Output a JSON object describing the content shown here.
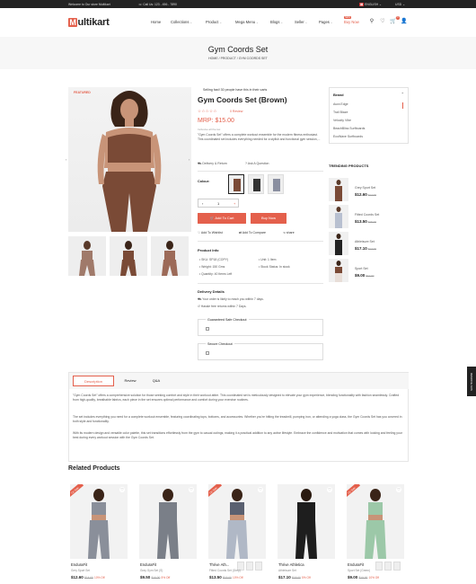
{
  "topbar": {
    "welcome": "Welcome to Our store Multikart",
    "phone": "Call Us: 123 - 456 - 7890",
    "language": "ENGLISH",
    "currency": "USD"
  },
  "logo": {
    "letter": "M",
    "rest": "ultikart"
  },
  "nav": {
    "items": [
      "Home",
      "Collections",
      "Product",
      "Mega Menu",
      "Blogs",
      "Seller",
      "Pages",
      "Buy Now"
    ],
    "new_badge": "NEW",
    "cart_count": "0"
  },
  "banner": {
    "title": "Gym Coords Set",
    "breadcrumb": "HOME  /  PRODUCT  /  GYM COORDS SET"
  },
  "gallery": {
    "featured": "FEATURED"
  },
  "product": {
    "selling_info": "Selling fast! 30 people have this in their carts",
    "title": "Gym Coords Set (Brown)",
    "stars": "☆☆☆☆☆",
    "review_link": "0 Review",
    "mrp": "MRP: $15.00",
    "tax": "Inclusive all the tax",
    "description": "\"Gym Coords Set\" offers a complete workout ensemble for the modern fitness enthusiast. This coordinated set includes everything needed for a stylish and functional gym session,...",
    "delivery_return": "Delivery & Return",
    "ask_question": "Ask A Question",
    "colour_label": "Colour:",
    "qty_minus": "‹",
    "qty_value": "1",
    "qty_plus": "+",
    "add_to_cart": "Add To Cart",
    "buy_now": "Buy Now",
    "wishlist": "Add To Wishlist",
    "compare": "Add To Compare",
    "share": "share",
    "info_heading": "Product Info",
    "info": {
      "sku": "SKU: SP18 (COPY)",
      "weight": "Weight: 150 Gms",
      "quantity": "Quantity: 40 Items Left",
      "unit": "Unit: 1 Item",
      "stock": "Stock Status: In stock"
    },
    "delivery_heading": "Delivery Details",
    "delivery_1": "Your order is likely to reach you within 7 days.",
    "delivery_2": "Hassle free returns within 7 Days.",
    "guaranteed": "Guaranteed Safe Checkout",
    "secure": "Secure Checkout"
  },
  "brand": {
    "heading": "Brand",
    "items": [
      "Aura Edge",
      "Trail Blaze",
      "Velocity Vibe",
      "BeachBliss Surfboards",
      "EcoWave Surfboards"
    ]
  },
  "trending": {
    "heading": "TRENDING PRODUCTS",
    "items": [
      {
        "name": "Grey Sport Set",
        "price": "$12.60",
        "old": "$14.00"
      },
      {
        "name": "Fitted Coords Set",
        "price": "$13.50",
        "old": "$15.00"
      },
      {
        "name": "Athleisure Set",
        "price": "$17.10",
        "old": "$17.00"
      },
      {
        "name": "Sport Set",
        "price": "$9.00",
        "old": "$10.00"
      }
    ]
  },
  "tabs": {
    "labels": [
      "Description",
      "Review",
      "Q&A"
    ],
    "p1": "\"Gym Coords Set\" offers a comprehensive solution for those seeking comfort and style in their workout attire. This coordinated set is meticulously designed to elevate your gym experience, blending functionality with fashion seamlessly. Crafted from high-quality, breathable fabrics, each piece in the set ensures optimal performance and comfort during your exercise routines.",
    "p2": "The set includes everything you need for a complete workout ensemble, featuring coordinating tops, bottoms, and accessories. Whether you're hitting the treadmill, pumping iron, or attending a yoga class, the Gym Coords Set has you covered in both style and functionality.",
    "p3": "With its modern design and versatile color palette, this set transitions effortlessly from the gym to casual outings, making it a practical addition to any active lifestyle. Embrace the confidence and motivation that comes with looking and feeling your best during every workout session with the Gym Coords Set."
  },
  "related": {
    "heading": "Related Products",
    "sale": "On Sale",
    "cards": [
      {
        "name": "EnduraFit",
        "sub": "Grey Sport Set",
        "price": "$12.60",
        "old": "$14.00",
        "off": "10% Off"
      },
      {
        "name": "EnduraFit",
        "sub": "Gray Gym Set (S)",
        "price": "$9.50",
        "old": "$10.00",
        "off": "5% Off"
      },
      {
        "name": "Thrive Ath...",
        "sub": "Fitted Coords Set (Grey)",
        "price": "$13.50",
        "old": "$15.00",
        "off": "10% Off"
      },
      {
        "name": "Thrive Athletica",
        "sub": "Athleisure Set",
        "price": "$17.10",
        "old": "$18.00",
        "off": "5% Off"
      },
      {
        "name": "EnduraFit",
        "sub": "Sport Set (Green)",
        "price": "$9.00",
        "old": "$10.00",
        "off": "10% Off"
      }
    ]
  },
  "side_tab": "REMOVE ADS",
  "colors": {
    "accent": "#e4604c",
    "topbar": "#232323",
    "banner": "#f7f7f7",
    "brown": "#7a4a36"
  }
}
